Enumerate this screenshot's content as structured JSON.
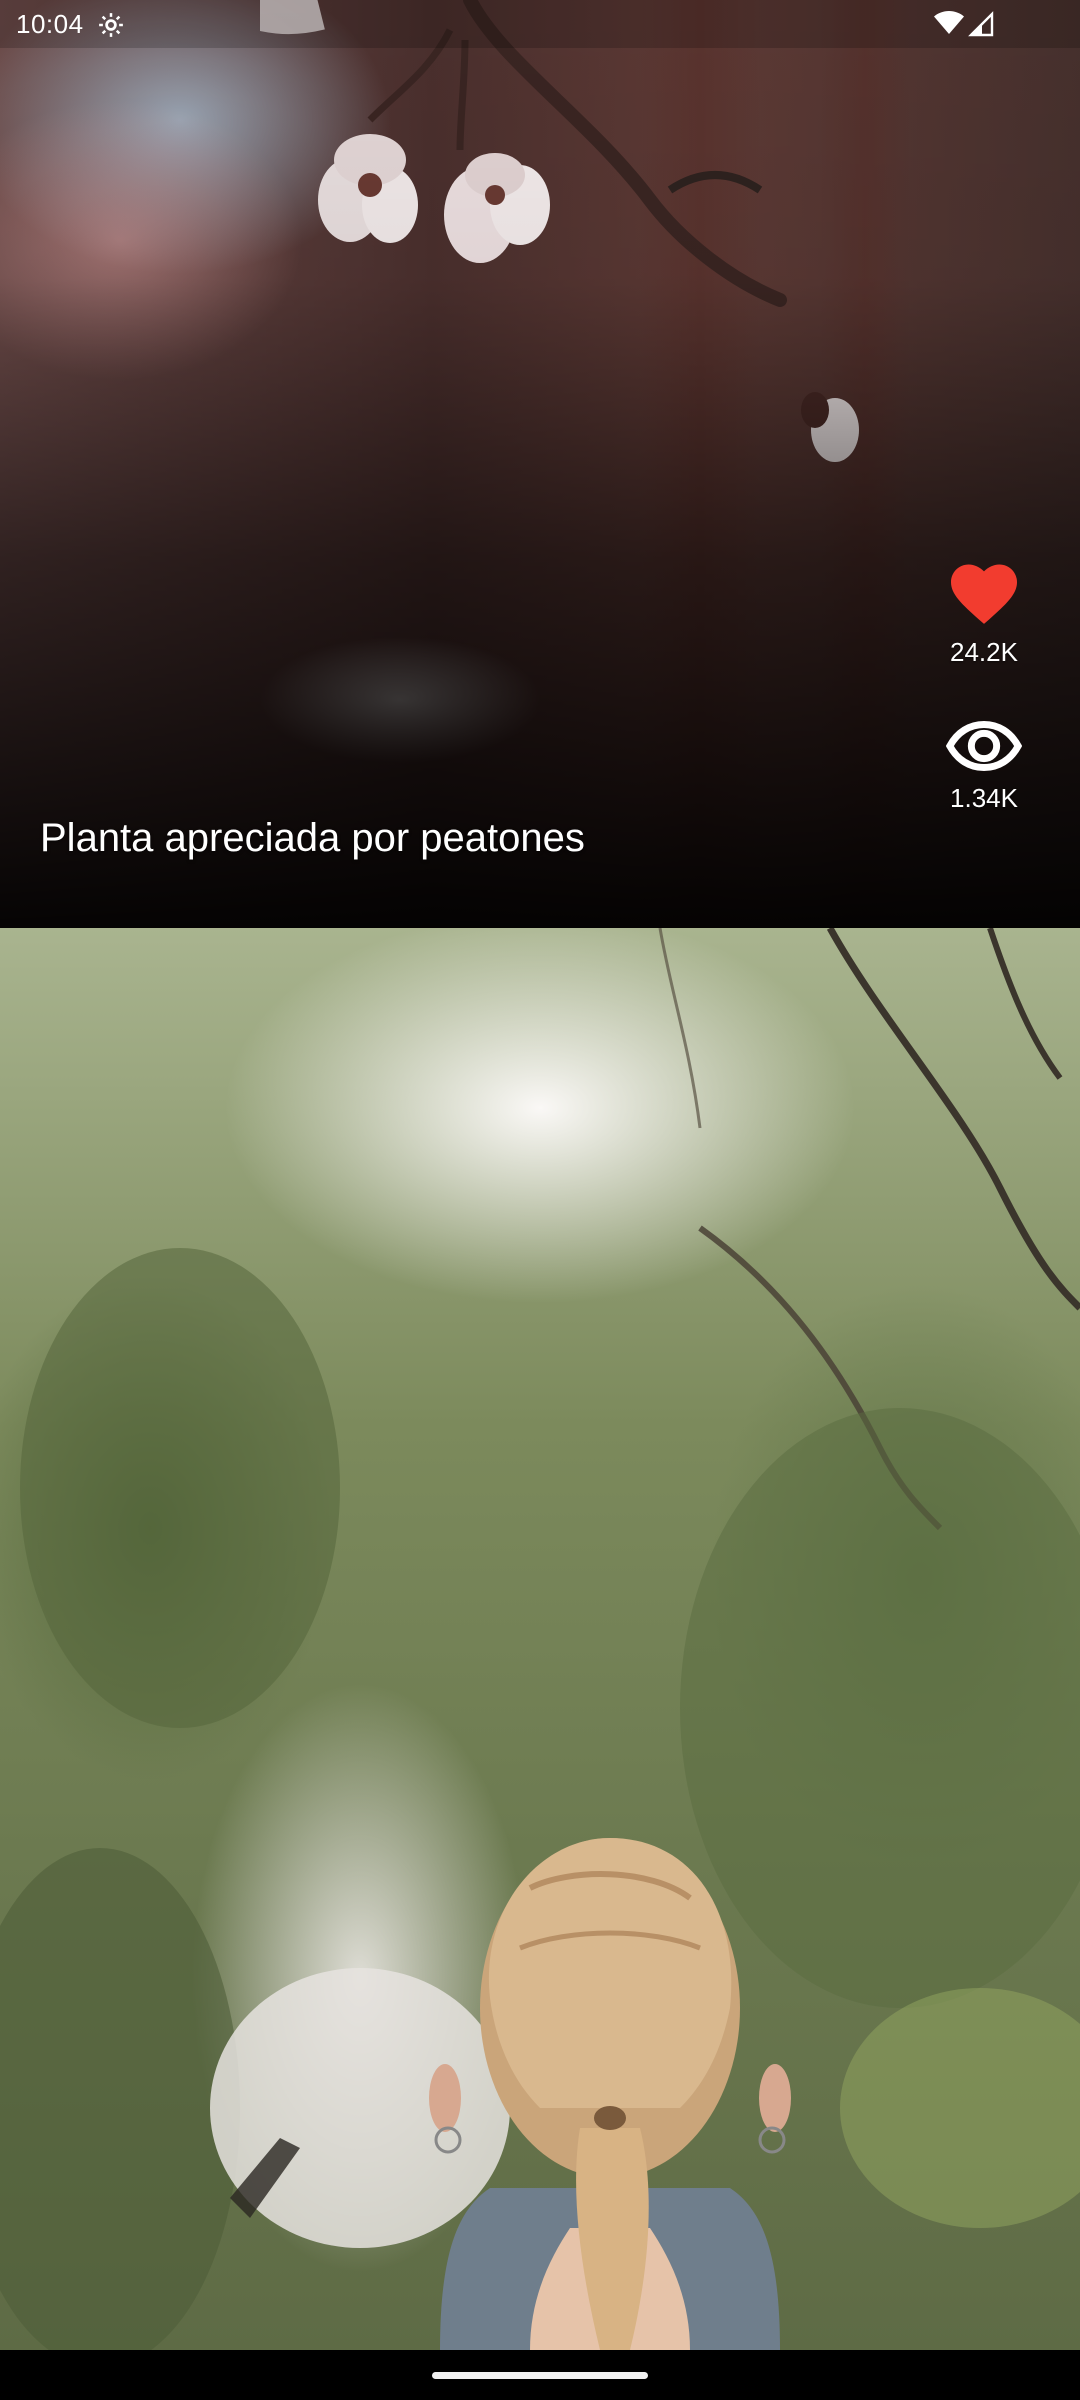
{
  "status_bar": {
    "time": "10:04",
    "icons": [
      "settings-gear-icon",
      "wifi-icon",
      "signal-icon"
    ]
  },
  "feed": {
    "items": [
      {
        "caption": "Planta apreciada por peatones",
        "likes": "24.2K",
        "views": "1.34K",
        "icons": {
          "like": "heart-icon",
          "views": "eye-icon"
        },
        "colors": {
          "heart": "#f23c2f"
        }
      },
      {
        "caption": "",
        "likes": "",
        "views": ""
      }
    ]
  },
  "nav_bar": {
    "gesture": "home-handle"
  }
}
